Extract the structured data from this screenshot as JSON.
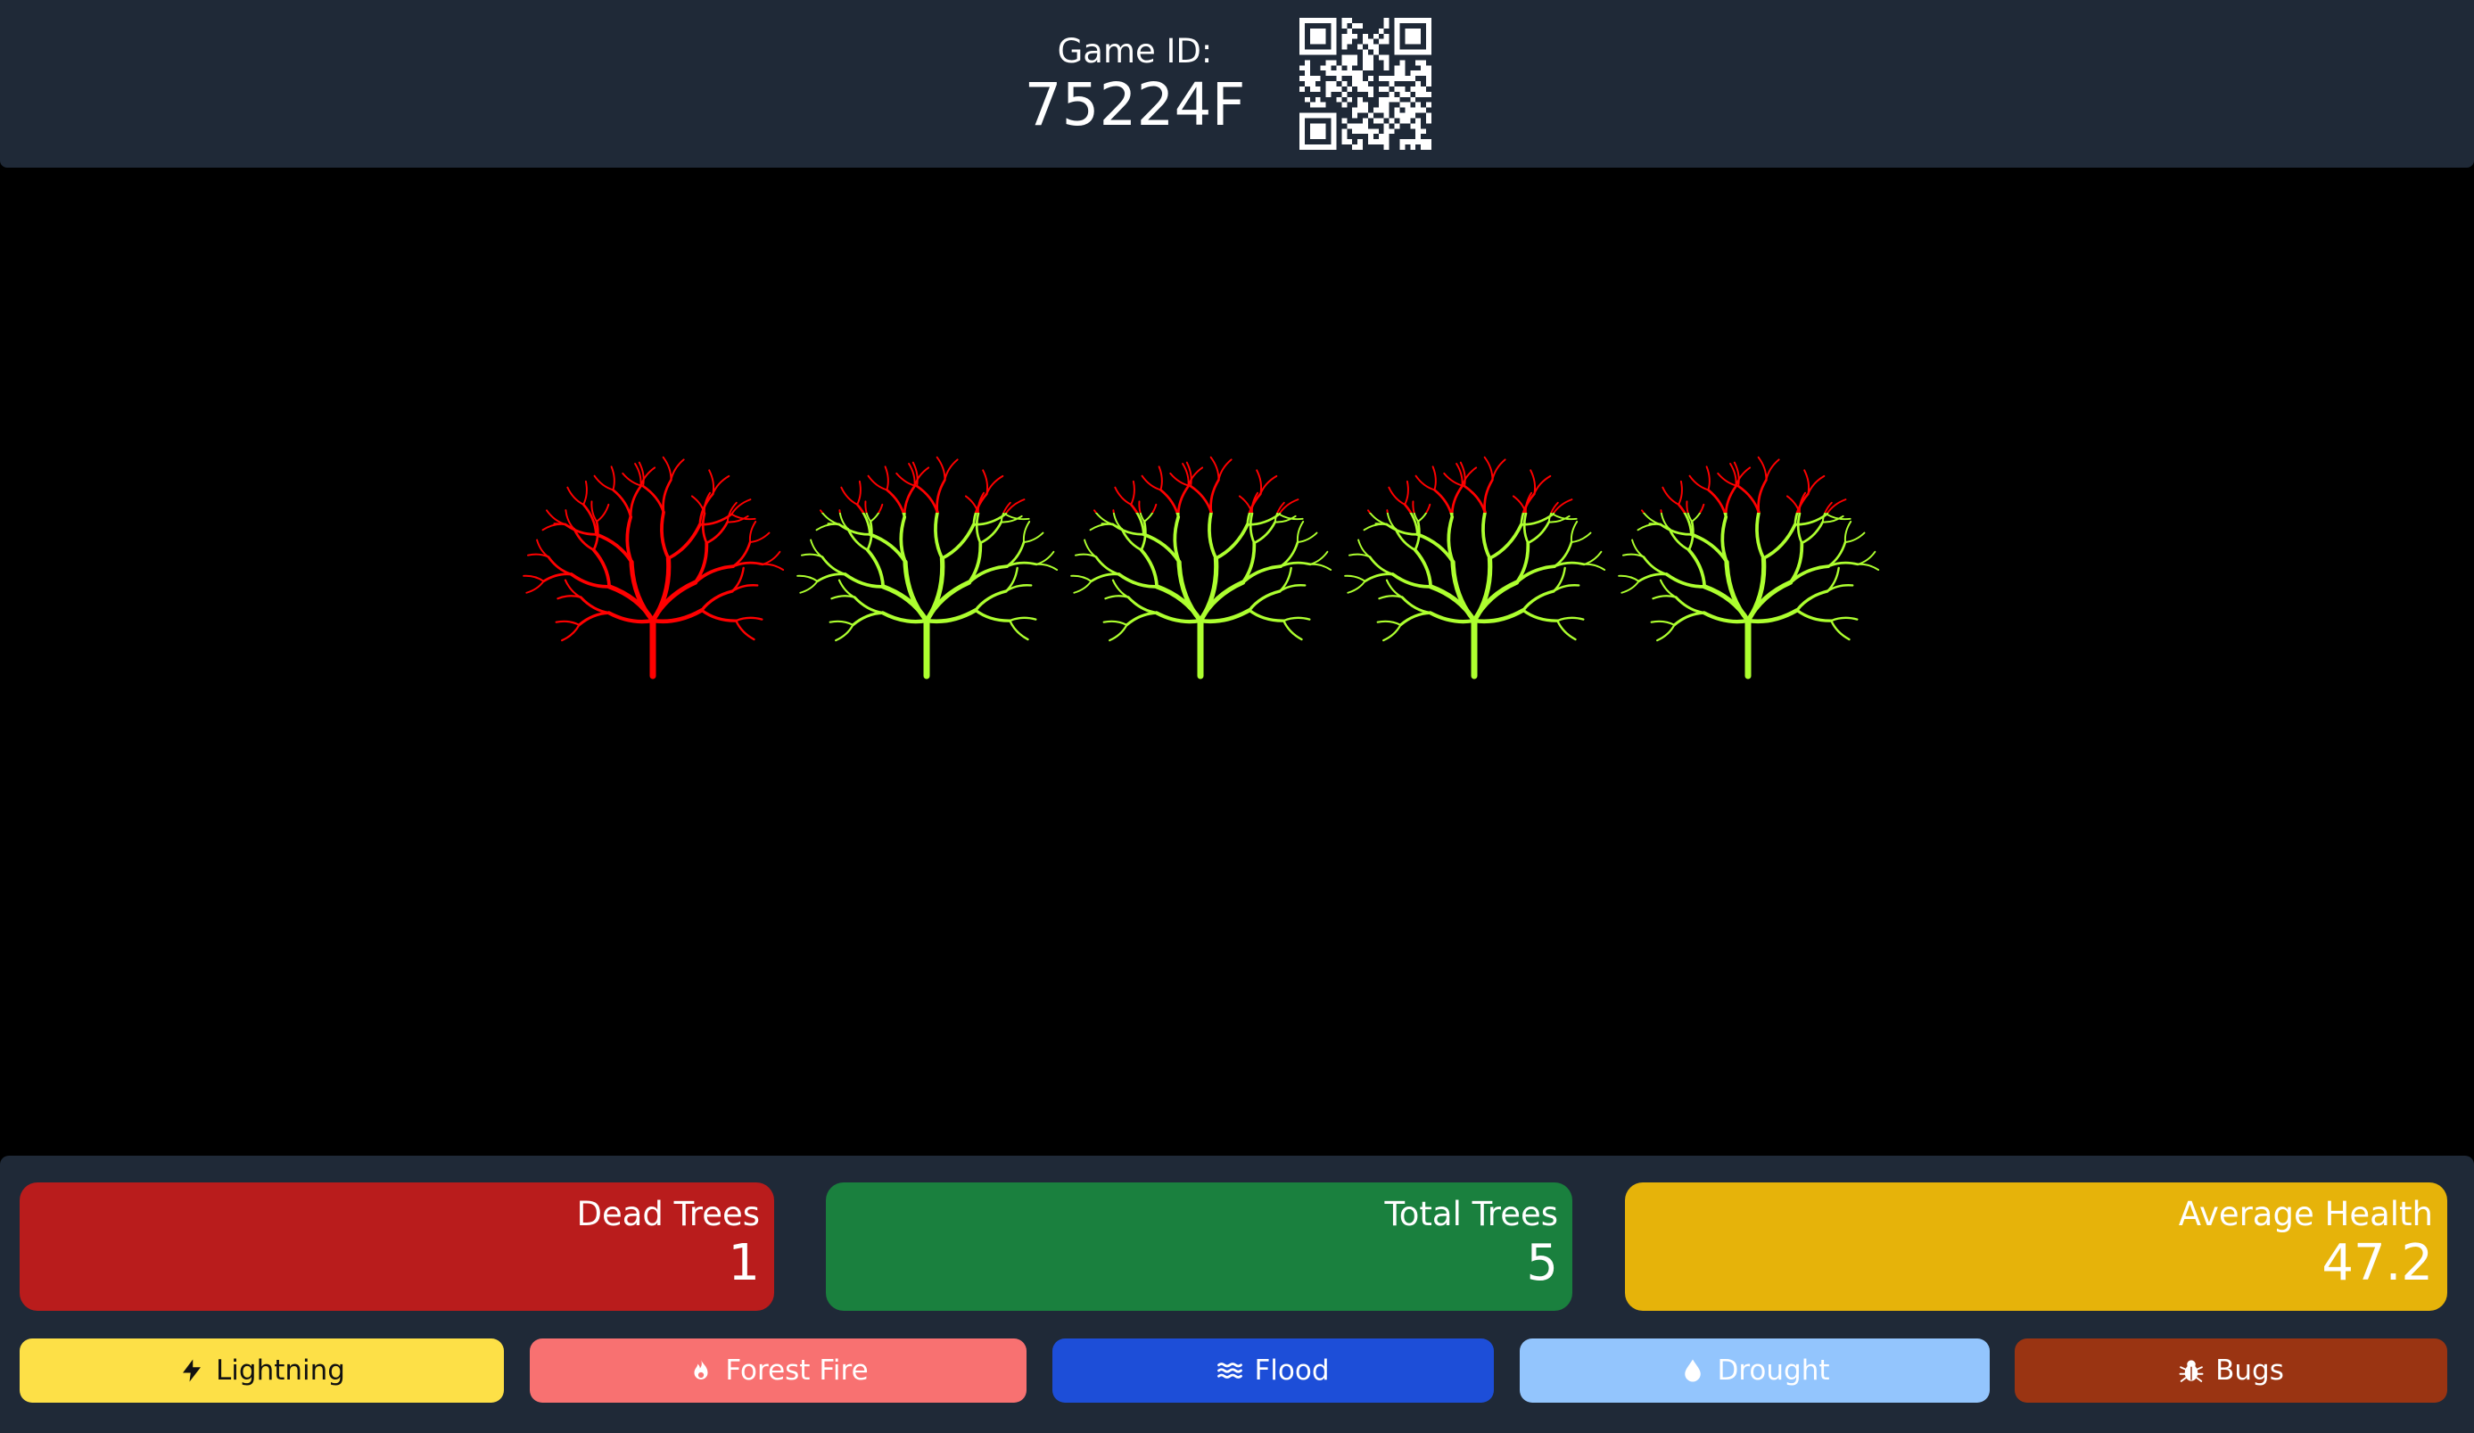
{
  "header": {
    "game_id_label": "Game ID:",
    "game_id": "75224F",
    "qr_icon": "qr-code-icon"
  },
  "trees": [
    {
      "status": "dead"
    },
    {
      "status": "damaged"
    },
    {
      "status": "damaged"
    },
    {
      "status": "damaged"
    },
    {
      "status": "damaged"
    }
  ],
  "colors": {
    "dead": "#ff0000",
    "healthy": "#adff2f"
  },
  "stats": {
    "dead_trees": {
      "label": "Dead Trees",
      "value": "1",
      "color": "#b91c1c"
    },
    "total_trees": {
      "label": "Total Trees",
      "value": "5",
      "color": "#1a803e"
    },
    "avg_health": {
      "label": "Average Health",
      "value": "47.2",
      "color": "#e6b30a"
    }
  },
  "actions": [
    {
      "label": "Lightning",
      "icon": "bolt-icon",
      "color": "#fde047",
      "text_color": "#111111"
    },
    {
      "label": "Forest Fire",
      "icon": "flame-icon",
      "color": "#f87171",
      "text_color": "#ffffff"
    },
    {
      "label": "Flood",
      "icon": "waves-icon",
      "color": "#1d4ed8",
      "text_color": "#ffffff"
    },
    {
      "label": "Drought",
      "icon": "droplet-icon",
      "color": "#93c5fd",
      "text_color": "#ffffff"
    },
    {
      "label": "Bugs",
      "icon": "bug-icon",
      "color": "#9a3412",
      "text_color": "#ffffff"
    }
  ]
}
